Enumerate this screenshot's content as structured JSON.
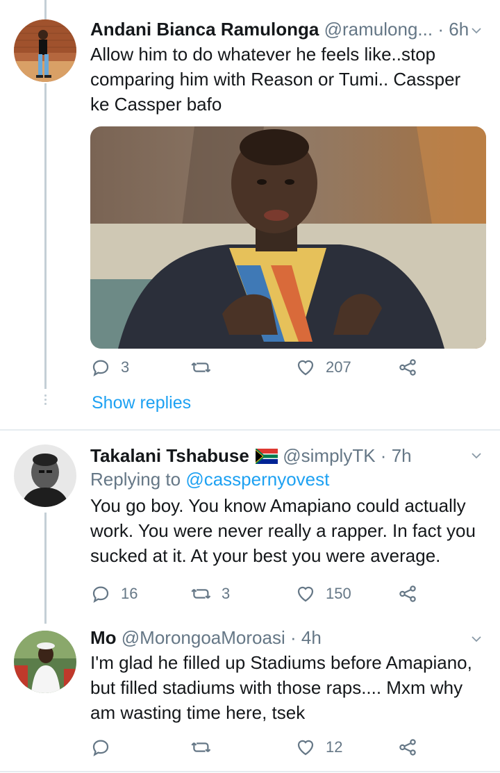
{
  "tweets": [
    {
      "name": "Andani Bianca Ramulonga",
      "handle": "@ramulong...",
      "sep": "·",
      "time": "6h",
      "text": "Allow him to do whatever he feels like..stop comparing him with Reason or Tumi.. Cassper ke Cassper bafo",
      "replies": "3",
      "retweets": "",
      "likes": "207",
      "show_replies": "Show replies",
      "avatar_icon": "person-photo",
      "media_icon": "man-on-couch-photo"
    },
    {
      "name": "Takalani Tshabuse",
      "flag_icon": "south-africa-flag",
      "handle": "@simplyTK",
      "sep": "·",
      "time": "7h",
      "replying_label": "Replying to",
      "replying_to": "@casspernyovest",
      "text": "You go boy. You know Amapiano could actually work. You were never really a rapper. In fact you sucked at it. At your best you were average.",
      "replies": "16",
      "retweets": "3",
      "likes": "150",
      "avatar_icon": "person-photo"
    },
    {
      "name": "Mo",
      "handle": "@MorongoaMoroasi",
      "sep": "·",
      "time": "4h",
      "text": "I'm glad he filled up Stadiums before Amapiano, but filled stadiums with those raps.... Mxm why am wasting time here, tsek",
      "replies": "",
      "retweets": "",
      "likes": "12",
      "avatar_icon": "person-photo"
    }
  ],
  "colors": {
    "link": "#1da1f2",
    "secondary": "#657786",
    "text": "#14171a",
    "divider": "#e6ecf0"
  }
}
